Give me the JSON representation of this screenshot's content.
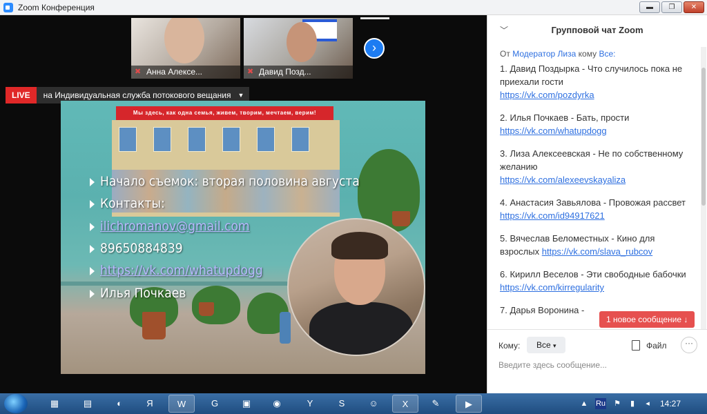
{
  "window": {
    "title": "Zoom Конференция"
  },
  "thumbnails": [
    {
      "name": "Анна Алексе..."
    },
    {
      "name": "Давид Позд..."
    }
  ],
  "live": {
    "badge": "LIVE",
    "text": "на Индивидуальная служба потокового вещания"
  },
  "stream": {
    "banner": "Мы здесь, как одна семья, живем, творим, мечтаем, верим!",
    "lines": [
      "Начало съемок: вторая половина августа",
      "Контакты:",
      "ilichromanov@gmail.com",
      "89650884839",
      "https://vk.com/whatupdogg",
      "Илья Почкаев"
    ]
  },
  "chat": {
    "title": "Групповой чат Zoom",
    "from_prefix": "От",
    "from_name": "Модератор Лиза",
    "to_word": "кому",
    "to_name": "Все:",
    "messages": [
      {
        "text": "1. Давид Поздырка - Что случилось пока не приехали гости",
        "link": "https://vk.com/pozdyrka"
      },
      {
        "text": "2. Илья Почкаев - Бать, прости",
        "link": "https://vk.com/whatupdogg"
      },
      {
        "text": "3. Лиза Алексеевская - Не по собственному желанию",
        "link": "https://vk.com/alexeevskayaliza"
      },
      {
        "text": "4. Анастасия Завьялова - Провожая рассвет",
        "link": "https://vk.com/id94917621"
      },
      {
        "text": "5. Вячеслав Беломестных - Кино для взрослых",
        "link": "https://vk.com/slava_rubcov"
      },
      {
        "text": "6. Кирилл Веселов - Эти свободные бабочки",
        "link": "https://vk.com/kirregularity"
      },
      {
        "text": "7. Дарья Воронина -",
        "link": ""
      }
    ],
    "new_message_badge": "1 новое сообщение ↓",
    "to_label": "Кому:",
    "to_value": "Все",
    "file_label": "Файл",
    "input_placeholder": "Введите здесь сообщение..."
  },
  "taskbar": {
    "lang": "Ru",
    "time": "14:27"
  }
}
